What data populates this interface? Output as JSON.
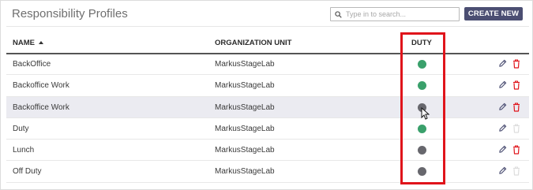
{
  "page": {
    "title": "Responsibility Profiles"
  },
  "search": {
    "placeholder": "Type in to search..."
  },
  "toolbar": {
    "create_label": "CREATE NEW"
  },
  "table": {
    "columns": {
      "name": "NAME",
      "org": "ORGANIZATION UNIT",
      "duty": "DUTY"
    },
    "sort": {
      "column": "NAME",
      "direction": "ascending"
    },
    "rows": [
      {
        "name": "BackOffice",
        "org": "MarkusStageLab",
        "duty": "green",
        "delete_enabled": true
      },
      {
        "name": "Backoffice Work",
        "org": "MarkusStageLab",
        "duty": "green",
        "delete_enabled": true
      },
      {
        "name": "Backoffice Work",
        "org": "MarkusStageLab",
        "duty": "gray",
        "delete_enabled": true,
        "hovered": true
      },
      {
        "name": "Duty",
        "org": "MarkusStageLab",
        "duty": "green",
        "delete_enabled": false
      },
      {
        "name": "Lunch",
        "org": "MarkusStageLab",
        "duty": "gray",
        "delete_enabled": true
      },
      {
        "name": "Off Duty",
        "org": "MarkusStageLab",
        "duty": "gray",
        "delete_enabled": false
      }
    ]
  },
  "colors": {
    "accent": "#4b4e72",
    "duty_green": "#3aa06b",
    "duty_gray": "#67676d",
    "edit_icon": "#4b4e72",
    "delete_icon": "#e0141b",
    "delete_icon_disabled": "#dddddd",
    "highlight_border": "#e0141b"
  }
}
